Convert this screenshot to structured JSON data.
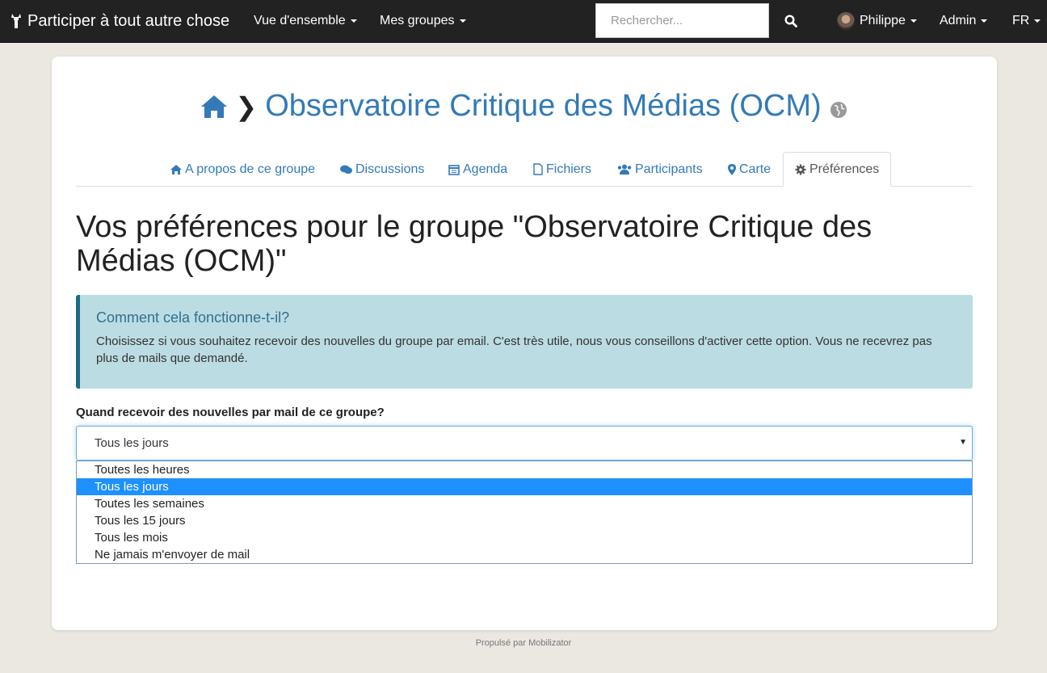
{
  "navbar": {
    "brand": "Participer à tout autre chose",
    "overview_label": "Vue d'ensemble",
    "groups_label": "Mes groupes",
    "search_placeholder": "Rechercher...",
    "user_name": "Philippe",
    "admin_label": "Admin",
    "lang_label": "FR"
  },
  "group": {
    "title": "Observatoire Critique des Médias (OCM)"
  },
  "tabs": [
    {
      "label": "A propos de ce groupe",
      "icon": "home-icon"
    },
    {
      "label": "Discussions",
      "icon": "comments-icon"
    },
    {
      "label": "Agenda",
      "icon": "calendar-icon"
    },
    {
      "label": "Fichiers",
      "icon": "file-icon"
    },
    {
      "label": "Participants",
      "icon": "users-icon"
    },
    {
      "label": "Carte",
      "icon": "map-marker-icon"
    },
    {
      "label": "Préférences",
      "icon": "gear-icon",
      "active": true
    }
  ],
  "page": {
    "heading": "Vos préférences pour le groupe \"Observatoire Critique des Médias (OCM)\"",
    "info_title": "Comment cela fonctionne-t-il?",
    "info_text": "Choisissez si vous souhaitez recevoir des nouvelles du groupe par email. C'est très utile, nous vous conseillons d'activer cette option. Vous ne recevrez pas plus de mails que demandé.",
    "field_label": "Quand recevoir des nouvelles par mail de ce groupe?",
    "selected_value": "Tous les jours",
    "options": [
      "Toutes les heures",
      "Tous les jours",
      "Toutes les semaines",
      "Tous les 15 jours",
      "Tous les mois",
      "Ne jamais m'envoyer de mail"
    ]
  },
  "footer": {
    "text": "Propulsé par Mobilizator"
  },
  "colors": {
    "navbar_bg": "#222222",
    "link": "#337ab7",
    "info_bg": "#bcdce3",
    "info_border": "#1b6d85",
    "option_selected": "#1e90ff"
  }
}
